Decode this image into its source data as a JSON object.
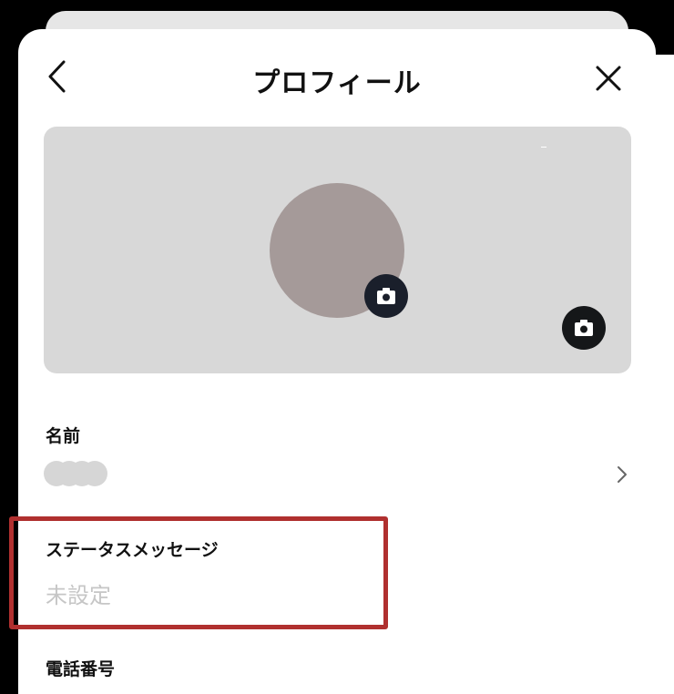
{
  "header": {
    "title": "プロフィール"
  },
  "profile": {
    "name_label": "名前",
    "status_label": "ステータスメッセージ",
    "status_value": "未設定",
    "phone_label": "電話番号"
  },
  "icons": {
    "back": "chevron-left-icon",
    "close": "close-icon",
    "avatar_camera": "camera-icon",
    "cover_camera": "camera-icon",
    "name_chevron": "chevron-right-icon"
  },
  "colors": {
    "highlight": "#b0302f",
    "avatar": "#a59a99",
    "cover": "#d8d8d8"
  }
}
